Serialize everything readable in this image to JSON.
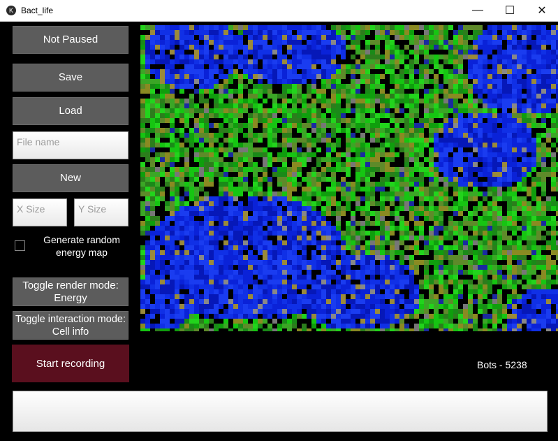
{
  "window": {
    "title": "Bact_life",
    "minimize_glyph": "—",
    "maximize_glyph": "☐",
    "close_glyph": "✕",
    "icon": "kivy-app-icon"
  },
  "sidebar": {
    "pause_label": "Not Paused",
    "save_label": "Save",
    "load_label": "Load",
    "file_name_placeholder": "File name",
    "new_label": "New",
    "x_size_placeholder": "X Size",
    "y_size_placeholder": "Y Size",
    "random_energy_label": "Generate random energy map",
    "random_energy_checked": false,
    "render_mode_label": "Toggle render mode: Energy",
    "interaction_mode_label": "Toggle interaction mode: Cell info",
    "record_label": "Start recording"
  },
  "status": {
    "bots_text": "Bots - 5238"
  },
  "colors": {
    "record_button": "#5a0f1e",
    "button": "#5c5c5c",
    "sim_green": "#12b310",
    "sim_blue": "#0a22d8"
  }
}
